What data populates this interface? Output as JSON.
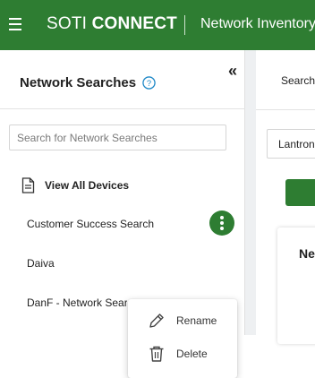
{
  "header": {
    "brand_part1": "SOTI",
    "brand_part2": "CONNECT",
    "module_title": "Network Inventory",
    "brand_color": "#2e7d32"
  },
  "sidebar": {
    "title": "Network Searches",
    "search_placeholder": "Search for Network Searches",
    "search_value": "",
    "view_all_label": "View All Devices",
    "items": [
      {
        "label": "Customer Success Search"
      },
      {
        "label": "Daiva"
      },
      {
        "label": "DanF - Network Search"
      }
    ]
  },
  "context_menu": {
    "rename_label": "Rename",
    "delete_label": "Delete"
  },
  "content": {
    "search_label": "Search",
    "select_value": "Lantronix",
    "card_title": "Ne"
  }
}
